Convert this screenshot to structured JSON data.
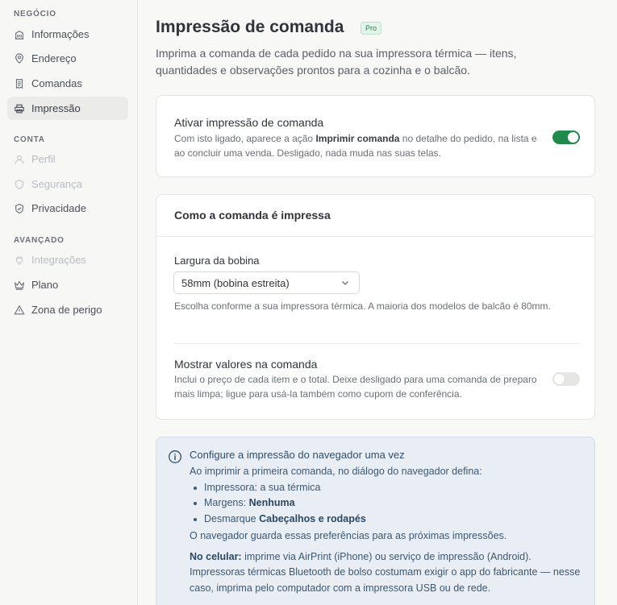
{
  "sidebar": {
    "sections": [
      {
        "label": "NEGÓCIO",
        "items": [
          {
            "label": "Informações",
            "icon": "building-icon",
            "state": "normal"
          },
          {
            "label": "Endereço",
            "icon": "map-pin-icon",
            "state": "normal"
          },
          {
            "label": "Comandas",
            "icon": "receipt-icon",
            "state": "normal"
          },
          {
            "label": "Impressão",
            "icon": "printer-icon",
            "state": "active"
          }
        ]
      },
      {
        "label": "CONTA",
        "items": [
          {
            "label": "Perfil",
            "icon": "user-icon",
            "state": "disabled"
          },
          {
            "label": "Segurança",
            "icon": "shield-icon",
            "state": "disabled"
          },
          {
            "label": "Privacidade",
            "icon": "shield-check-icon",
            "state": "normal"
          }
        ]
      },
      {
        "label": "AVANÇADO",
        "items": [
          {
            "label": "Integrações",
            "icon": "plug-icon",
            "state": "disabled"
          },
          {
            "label": "Plano",
            "icon": "crown-icon",
            "state": "normal"
          },
          {
            "label": "Zona de perigo",
            "icon": "warning-triangle-icon",
            "state": "normal"
          }
        ]
      }
    ]
  },
  "header": {
    "title": "Impressão de comanda",
    "badge": "Pro",
    "subtitle": "Imprima a comanda de cada pedido na sua impressora térmica — itens, quantidades e observações prontos para a cozinha e o balcão."
  },
  "enable_card": {
    "title": "Ativar impressão de comanda",
    "desc_before": "Com isto ligado, aparece a ação ",
    "desc_bold": "Imprimir comanda",
    "desc_after": " no detalhe do pedido, na lista e ao concluir uma venda. Desligado, nada muda nas suas telas.",
    "toggle_on": true
  },
  "print_card": {
    "title": "Como a comanda é impressa",
    "width_label": "Largura da bobina",
    "width_value": "58mm (bobina estreita)",
    "width_help": "Escolha conforme a sua impressora térmica. A maioria dos modelos de balcão é 80mm.",
    "values_title": "Mostrar valores na comanda",
    "values_desc": "Inclui o preço de cada item e o total. Deixe desligado para uma comanda de preparo mais limpa; ligue para usá-la também como cupom de conferência.",
    "values_toggle_on": false
  },
  "info": {
    "title": "Configure a impressão do navegador uma vez",
    "intro": "Ao imprimir a primeira comanda, no diálogo do navegador defina:",
    "items": [
      {
        "text": "Impressora: a sua térmica",
        "bold": ""
      },
      {
        "text": "Margens: ",
        "bold": "Nenhuma"
      },
      {
        "text": "Desmarque ",
        "bold": "Cabeçalhos e rodapés"
      }
    ],
    "note": "O navegador guarda essas preferências para as próximas impressões.",
    "mobile_bold": "No celular:",
    "mobile_text": " imprime via AirPrint (iPhone) ou serviço de impressão (Android). Impressoras térmicas Bluetooth de bolso costumam exigir o app do fabricante — nesse caso, imprima pelo computador com a impressora USB ou de rede."
  },
  "colors": {
    "accent": "#1f8a4c",
    "info_bg": "#e9eef4",
    "sidebar_active": "#ebebea"
  }
}
